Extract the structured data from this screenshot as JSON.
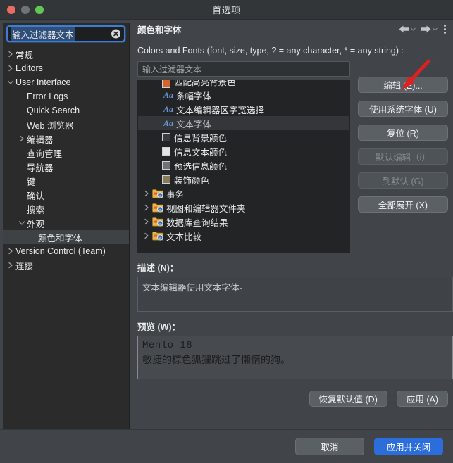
{
  "window": {
    "title": "首选项",
    "traffic_lights": [
      "close-button",
      "minimize-button",
      "zoom-button"
    ]
  },
  "sidebar": {
    "filter": {
      "value": "输入过滤器文本",
      "placeholder": "输入过滤器文本",
      "clear_icon": "clear-circle-icon"
    },
    "items": [
      {
        "label": "常规",
        "indent": 0,
        "twisty": "collapsed",
        "selected": false
      },
      {
        "label": "Editors",
        "indent": 0,
        "twisty": "collapsed",
        "selected": false
      },
      {
        "label": "User Interface",
        "indent": 0,
        "twisty": "expanded",
        "selected": false
      },
      {
        "label": "Error Logs",
        "indent": 1,
        "twisty": "none",
        "selected": false
      },
      {
        "label": "Quick Search",
        "indent": 1,
        "twisty": "none",
        "selected": false
      },
      {
        "label": "Web 浏览器",
        "indent": 1,
        "twisty": "none",
        "selected": false
      },
      {
        "label": "编辑器",
        "indent": 1,
        "twisty": "collapsed",
        "selected": false
      },
      {
        "label": "查询管理",
        "indent": 1,
        "twisty": "none",
        "selected": false
      },
      {
        "label": "导航器",
        "indent": 1,
        "twisty": "none",
        "selected": false
      },
      {
        "label": "键",
        "indent": 1,
        "twisty": "none",
        "selected": false
      },
      {
        "label": "确认",
        "indent": 1,
        "twisty": "none",
        "selected": false
      },
      {
        "label": "搜索",
        "indent": 1,
        "twisty": "none",
        "selected": false
      },
      {
        "label": "外观",
        "indent": 1,
        "twisty": "expanded",
        "selected": false
      },
      {
        "label": "颜色和字体",
        "indent": 2,
        "twisty": "none",
        "selected": true
      },
      {
        "label": "Version Control (Team)",
        "indent": 0,
        "twisty": "collapsed",
        "selected": false
      },
      {
        "label": "连接",
        "indent": 0,
        "twisty": "collapsed",
        "selected": false
      }
    ]
  },
  "main": {
    "header": {
      "title": "颜色和字体",
      "back_icon": "arrow-left-icon",
      "forward_icon": "arrow-right-icon",
      "menu_icon": "kebab-menu-icon"
    },
    "caption": "Colors and Fonts (font, size, type, ? = any character, * = any string) :",
    "filter": {
      "value": "",
      "placeholder": "输入过滤器文本"
    },
    "tree": [
      {
        "label": "匹配高亮背景色",
        "icon": "color-swatch",
        "color": "#d4642a",
        "indent": 1,
        "twisty": "none",
        "selected": false,
        "clipped": true
      },
      {
        "label": "条幅字体",
        "icon": "font-aa",
        "indent": 1,
        "twisty": "none",
        "selected": false,
        "clipped": false
      },
      {
        "label": "文本编辑器区字宽选择",
        "icon": "font-aa",
        "indent": 1,
        "twisty": "none",
        "selected": false,
        "clipped": false
      },
      {
        "label": "文本字体",
        "icon": "font-aa",
        "indent": 1,
        "twisty": "none",
        "selected": true,
        "clipped": false
      },
      {
        "label": "信息背景颜色",
        "icon": "color-swatch",
        "color": "#3a3d40",
        "indent": 1,
        "twisty": "none",
        "selected": false,
        "clipped": false
      },
      {
        "label": "信息文本颜色",
        "icon": "color-swatch",
        "color": "#e2e4e6",
        "indent": 1,
        "twisty": "none",
        "selected": false,
        "clipped": false
      },
      {
        "label": "预选信息颜色",
        "icon": "color-swatch",
        "color": "#6d7276",
        "indent": 1,
        "twisty": "none",
        "selected": false,
        "clipped": false
      },
      {
        "label": "装饰颜色",
        "icon": "color-swatch",
        "color": "#8a7a5a",
        "indent": 1,
        "twisty": "none",
        "selected": false,
        "clipped": false
      },
      {
        "label": "事务",
        "icon": "folder",
        "indent": 0,
        "twisty": "collapsed",
        "selected": false,
        "clipped": false
      },
      {
        "label": "视图和编辑器文件夹",
        "icon": "folder",
        "indent": 0,
        "twisty": "collapsed",
        "selected": false,
        "clipped": false
      },
      {
        "label": "数据库查询结果",
        "icon": "folder",
        "indent": 0,
        "twisty": "collapsed",
        "selected": false,
        "clipped": false
      },
      {
        "label": "文本比较",
        "icon": "folder",
        "indent": 0,
        "twisty": "collapsed",
        "selected": false,
        "clipped": false
      }
    ],
    "side_buttons": [
      {
        "label": "编辑 (E)...",
        "enabled": true
      },
      {
        "label": "使用系统字体 (U)",
        "enabled": true
      },
      {
        "label": "复位 (R)",
        "enabled": true
      },
      {
        "label": "默认编辑（i）",
        "enabled": false
      },
      {
        "label": "到默认 (G)",
        "enabled": false
      },
      {
        "label": "全部展开 (X)",
        "enabled": true
      }
    ],
    "description": {
      "label": "描述 (N)：",
      "text": "文本编辑器使用文本字体。"
    },
    "preview": {
      "label": "预览 (W)：",
      "line1": "Menlo  18",
      "line2": "敏捷的棕色狐狸跳过了懒惰的狗。"
    },
    "pane_buttons": [
      {
        "label": "恢复默认值 (D)",
        "primary": false
      },
      {
        "label": "应用 (A)",
        "primary": false
      }
    ]
  },
  "dialog_footer": [
    {
      "label": "取消",
      "primary": false
    },
    {
      "label": "应用并关闭",
      "primary": true
    }
  ],
  "annotation": {
    "arrow_color": "#e02020",
    "points_to": "编辑 (E)..."
  },
  "colors": {
    "accent": "#2b6ddb",
    "focus_ring": "#3b7fd4",
    "window_bg": "#414549",
    "sidebar_bg": "#2b2b2b",
    "tree_bg": "#232425"
  }
}
